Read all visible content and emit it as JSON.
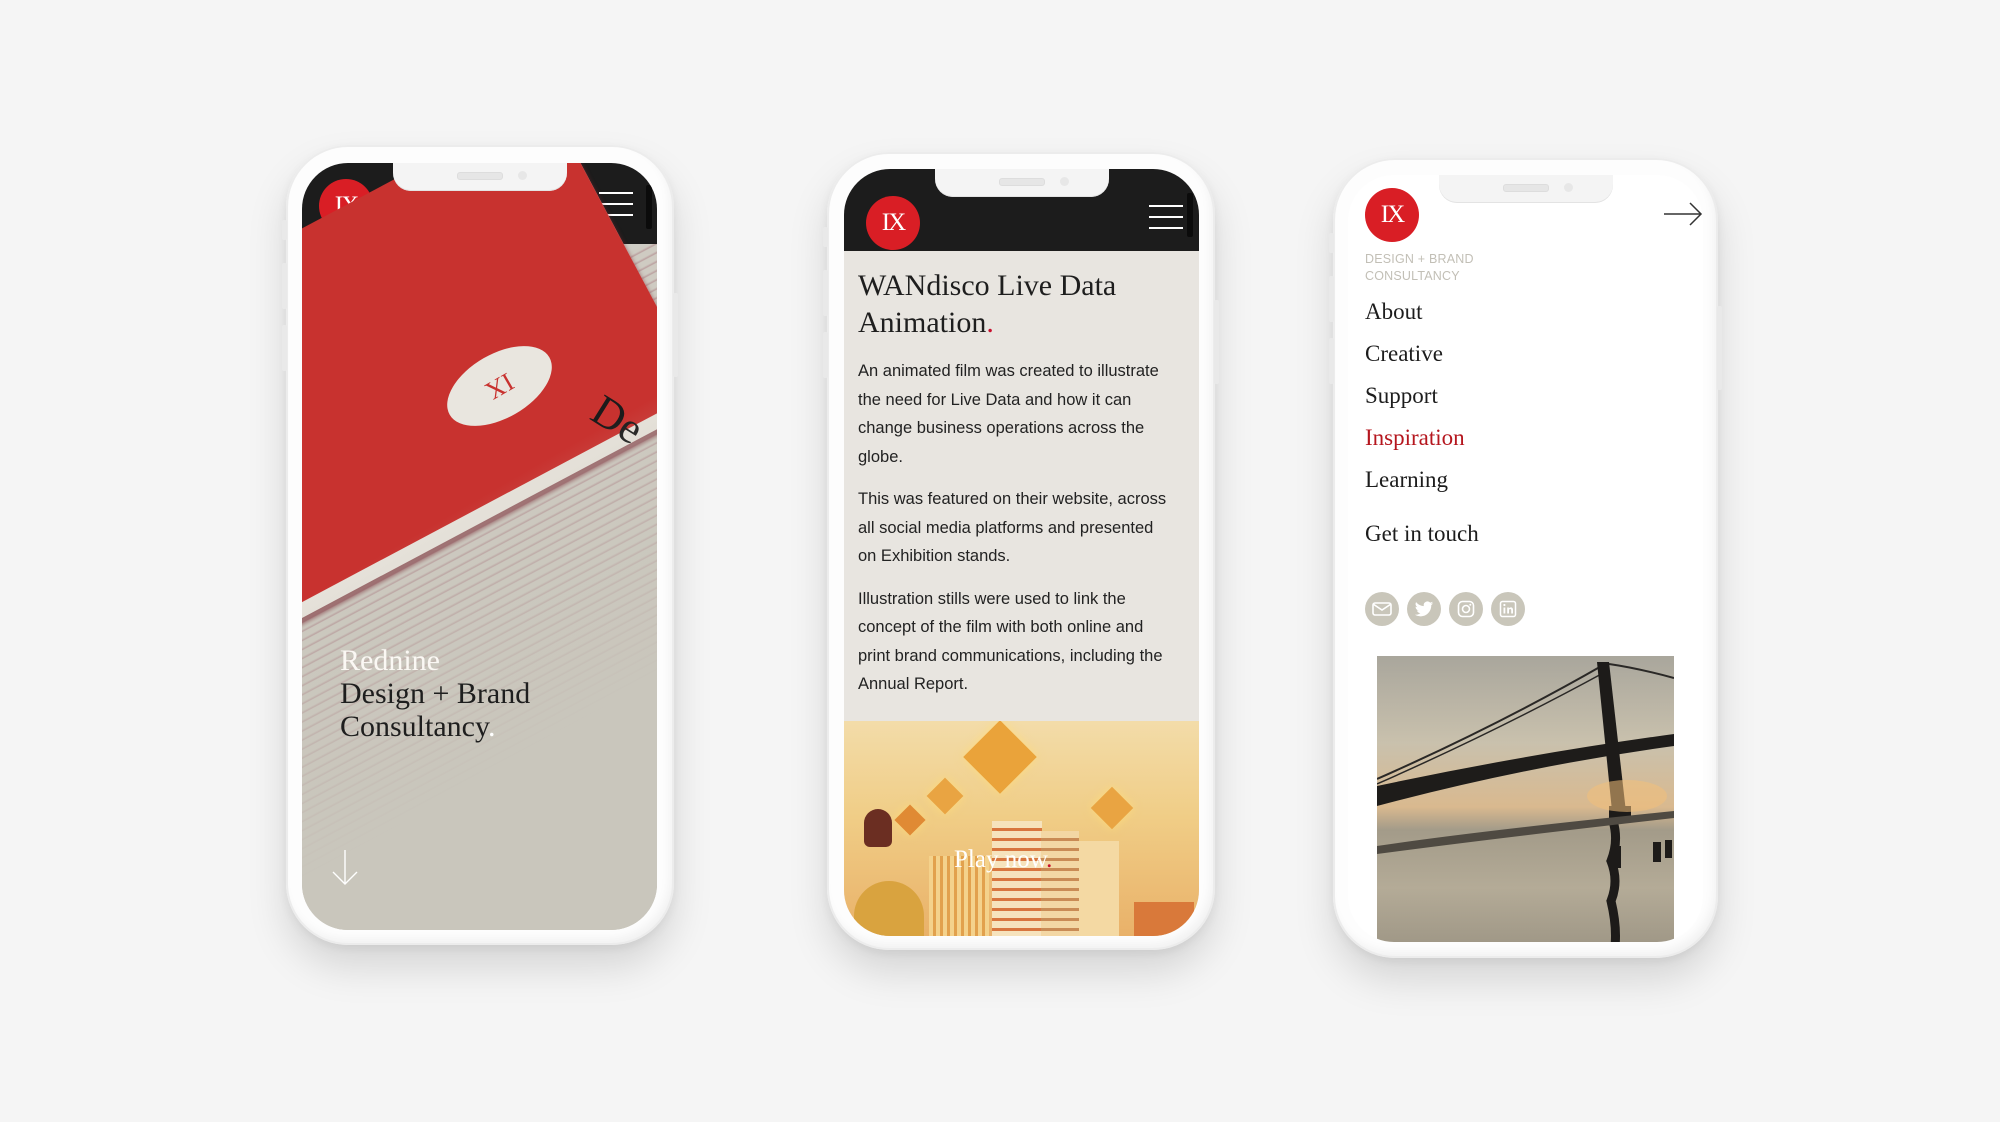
{
  "brand": {
    "logo_text": "IX",
    "accent_color": "#d91e25",
    "active_color": "#b5161e"
  },
  "phone1": {
    "menu_icon": "hamburger-icon",
    "card_logo": "IX",
    "card_text": "De",
    "tagline": {
      "line1": "Rednine",
      "line2": "Design + Brand",
      "line3": "Consultancy",
      "dot": "."
    },
    "scroll_icon": "arrow-down-icon"
  },
  "phone2": {
    "menu_icon": "hamburger-icon",
    "title_line1": "WANdisco Live Data",
    "title_line2": "Animation",
    "title_dot": ".",
    "paragraphs": [
      "An animated film was created to illustrate the need for Live Data and how it can change business operations across the globe.",
      "This was featured on their website, across all social media platforms and presented on Exhibition stands.",
      "Illustration stills were used to link the concept of the film with both online and print brand communications, including the Annual Report."
    ],
    "video": {
      "play_label": "Play now",
      "play_dot": "."
    }
  },
  "phone3": {
    "close_icon": "arrow-right-icon",
    "subtitle_line1": "DESIGN + BRAND",
    "subtitle_line2": "CONSULTANCY",
    "nav": [
      {
        "label": "About",
        "active": false
      },
      {
        "label": "Creative",
        "active": false
      },
      {
        "label": "Support",
        "active": false
      },
      {
        "label": "Inspiration",
        "active": true
      },
      {
        "label": "Learning",
        "active": false
      }
    ],
    "get_in_touch": "Get in touch",
    "socials": [
      "email-icon",
      "twitter-icon",
      "instagram-icon",
      "linkedin-icon"
    ]
  }
}
